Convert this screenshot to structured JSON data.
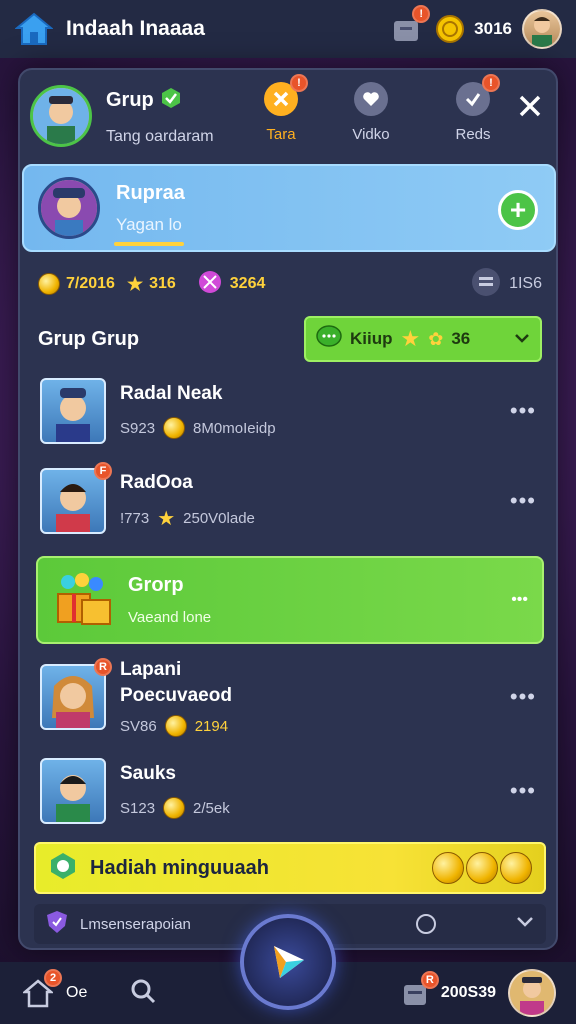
{
  "topbar": {
    "title": "Indaah Inaaaa",
    "notif_badge": "!",
    "coin_count": "3016"
  },
  "panel": {
    "group_name": "Grup",
    "group_subtitle": "Tang oardaram",
    "tabs": [
      {
        "label": "Tara",
        "badge": "!",
        "icon": "close-x-icon"
      },
      {
        "label": "Vidko",
        "icon": "heart-icon"
      },
      {
        "label": "Reds",
        "badge": "!",
        "icon": "check-icon"
      }
    ],
    "active": {
      "name": "Rupraa",
      "subtitle": "Yagan lo"
    },
    "stats": {
      "gold": "7/2016",
      "star": "316",
      "gem": "3264",
      "players": "1IS6"
    },
    "section_title": "Grup Grup",
    "filter": {
      "label": "Kiiup",
      "value": "36"
    },
    "members": [
      {
        "name": "Radal Neak",
        "count": "S923",
        "desc": "8M0moIeidp"
      },
      {
        "name": "RadOoa",
        "count": "!773",
        "desc": "250V0lade",
        "badge": "F"
      },
      {
        "name": "Lapani Poecuvaeod",
        "count": "SV86",
        "desc": "2194",
        "badge": "R"
      },
      {
        "name": "Sauks",
        "count": "S123",
        "desc": "2/5ek"
      }
    ],
    "group_row": {
      "name": "Grorp",
      "subtitle": "Vaeand lone"
    },
    "banner": "Hadiah minguuaah",
    "footer": "Lmsenserapoian"
  },
  "bottombar": {
    "left_value": "Oe",
    "right_value": "200S39",
    "badge": "2"
  },
  "colors": {
    "accent": "#74b8ef",
    "green": "#5cc93a",
    "yellow": "#f7e236",
    "panel": "#2c3350"
  }
}
